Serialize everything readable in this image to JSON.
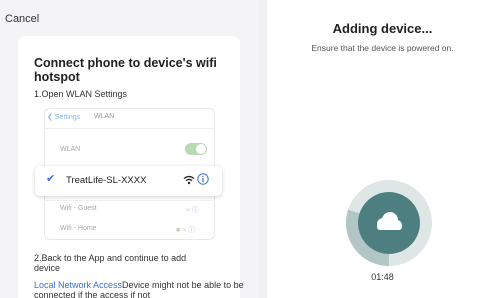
{
  "left": {
    "cancel": "Cancel",
    "title": "Connect phone to device's wifi hotspot",
    "step1": "1.Open WLAN Settings",
    "mock": {
      "back": "Settings",
      "header": "WLAN",
      "wlan_label": "WLAN",
      "selected_ssid": "TreatLife-SL-XXXX",
      "other_networks": [
        "Wifi - Guest",
        "Wifi - Home"
      ]
    },
    "step2": "2.Back to the App and continue to add device",
    "note_link": "Local Network Access",
    "note_text": "Device might not be able to be connected if the access if not"
  },
  "right": {
    "title": "Adding device...",
    "subtitle": "Ensure that the device is powered on.",
    "timer": "01:48",
    "progress_fraction": 0.3,
    "colors": {
      "accent": "#4e7f80",
      "ring": "#b2c6c6",
      "track": "#dfe7e6"
    }
  },
  "icons": {
    "back": "chevron-left-icon",
    "check": "checkmark-icon",
    "wifi": "wifi-icon",
    "info": "info-icon",
    "lock": "lock-icon",
    "cloud": "cloud-icon"
  }
}
